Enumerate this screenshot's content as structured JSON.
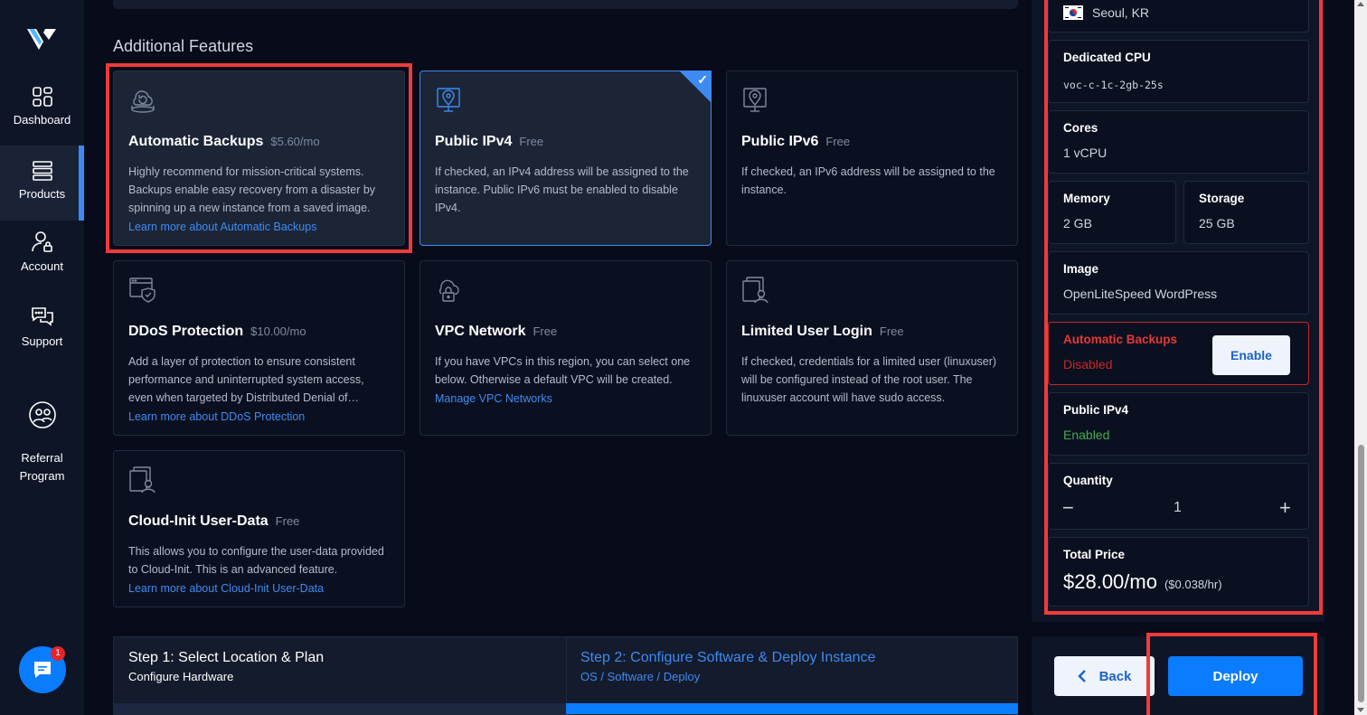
{
  "sidebar": {
    "items": [
      {
        "label": "Dashboard",
        "icon": "dashboard-grid-icon"
      },
      {
        "label": "Products",
        "icon": "server-stack-icon",
        "active": true
      },
      {
        "label": "Account",
        "icon": "user-lock-icon"
      },
      {
        "label": "Support",
        "icon": "chat-bubbles-icon"
      },
      {
        "label": "Referral\nProgram",
        "icon": "referral-people-icon"
      }
    ],
    "chat_badge": "1"
  },
  "section_title": "Additional Features",
  "features": [
    {
      "title": "Automatic Backups",
      "price": "$5.60/mo",
      "desc": "Highly recommend for mission-critical systems. Backups enable easy recovery from a disaster by spinning up a new instance from a saved image.",
      "link": "Learn more about Automatic Backups"
    },
    {
      "title": "Public IPv4",
      "price": "Free",
      "desc": "If checked, an IPv4 address will be assigned to the instance. Public IPv6 must be enabled to disable IPv4.",
      "link": ""
    },
    {
      "title": "Public IPv6",
      "price": "Free",
      "desc": "If checked, an IPv6 address will be assigned to the instance.",
      "link": ""
    },
    {
      "title": "DDoS Protection",
      "price": "$10.00/mo",
      "desc": "Add a layer of protection to ensure consistent performance and uninterrupted system access, even when targeted by Distributed Denial of…",
      "link": "Learn more about DDoS Protection"
    },
    {
      "title": "VPC Network",
      "price": "Free",
      "desc": "If you have VPCs in this region, you can select one below. Otherwise a default VPC will be created.",
      "link": "Manage VPC Networks"
    },
    {
      "title": "Limited User Login",
      "price": "Free",
      "desc": "If checked, credentials for a limited user (linuxuser) will be configured instead of the root user. The linuxuser account will have sudo access.",
      "link": ""
    },
    {
      "title": "Cloud-Init User-Data",
      "price": "Free",
      "desc": "This allows you to configure the user-data provided to Cloud-Init. This is an advanced feature.",
      "link": "Learn more about Cloud-Init User-Data"
    }
  ],
  "steps": {
    "step1_title": "Step 1: Select Location & Plan",
    "step1_sub": "Configure Hardware",
    "step2_title": "Step 2: Configure Software & Deploy Instance",
    "step2_sub": "OS / Software / Deploy"
  },
  "summary": {
    "location": "Seoul, KR",
    "plan_label": "Dedicated CPU",
    "plan_value": "voc-c-1c-2gb-25s",
    "cores_label": "Cores",
    "cores_value": "1 vCPU",
    "memory_label": "Memory",
    "memory_value": "2 GB",
    "storage_label": "Storage",
    "storage_value": "25 GB",
    "image_label": "Image",
    "image_value": "OpenLiteSpeed WordPress",
    "backups_label": "Automatic Backups",
    "backups_value": "Disabled",
    "enable_label": "Enable",
    "ipv4_label": "Public IPv4",
    "ipv4_value": "Enabled",
    "quantity_label": "Quantity",
    "quantity_value": "1",
    "minus": "−",
    "plus": "+",
    "total_label": "Total Price",
    "total_value": "$28.00/mo",
    "total_hourly": "($0.038/hr)"
  },
  "actions": {
    "back_label": "Back",
    "deploy_label": "Deploy"
  },
  "colors": {
    "accent": "#0a7cff",
    "highlight": "#ef3b3b",
    "disabled_text": "#d32f2f",
    "enabled_text": "#3fae4a"
  }
}
